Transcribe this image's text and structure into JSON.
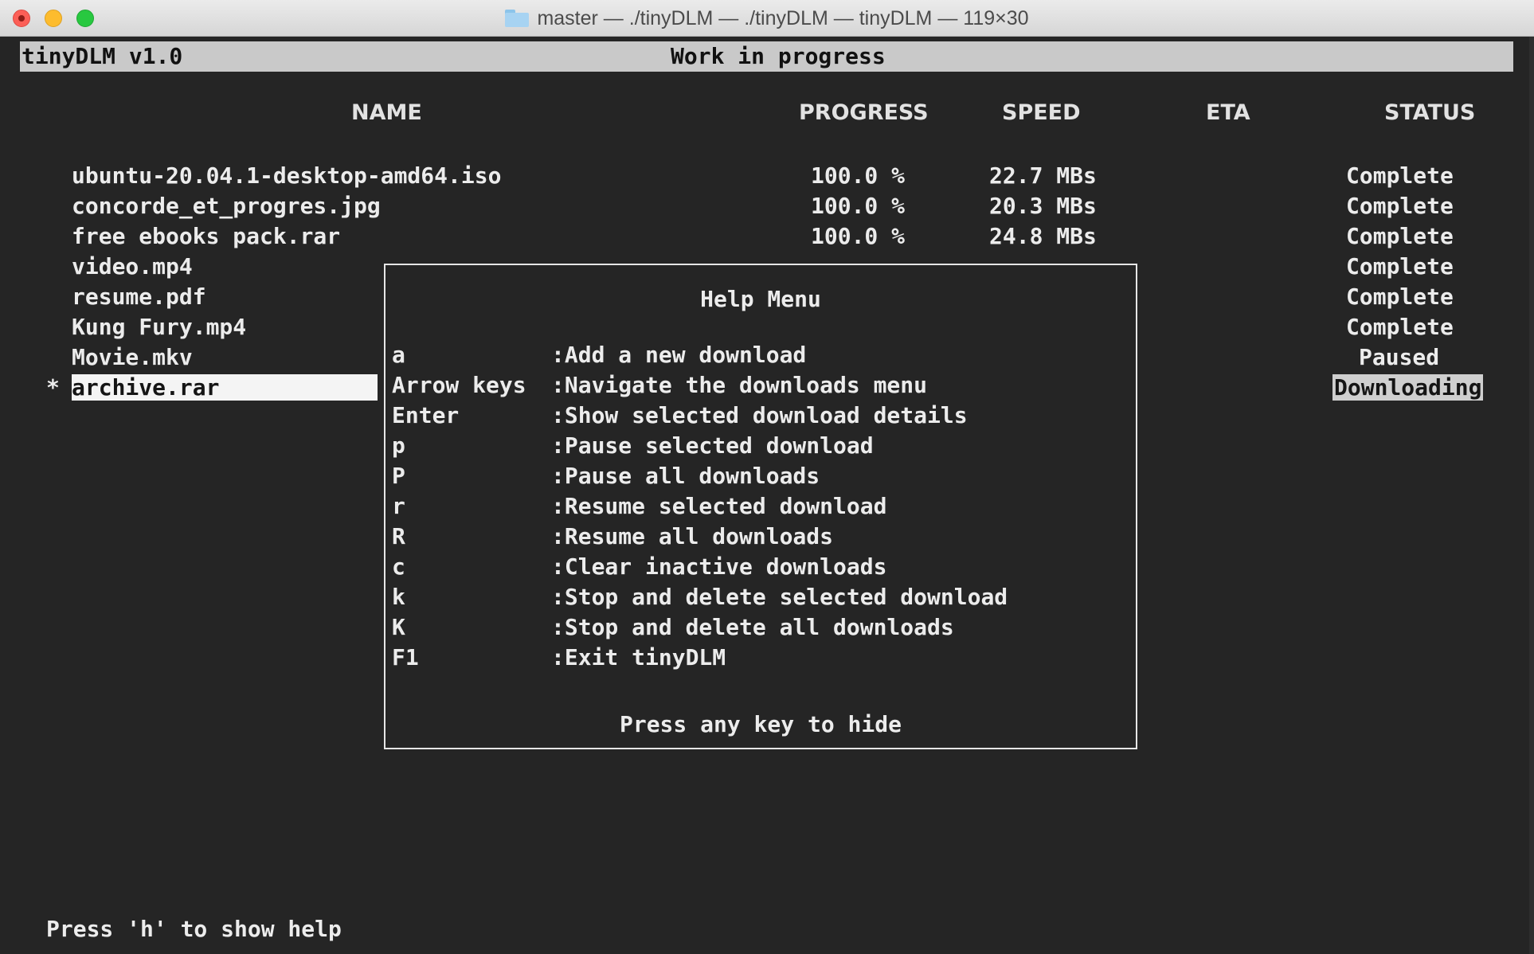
{
  "window": {
    "title": "master — ./tinyDLM — ./tinyDLM — tinyDLM — 119×30"
  },
  "header": {
    "app_name": "tinyDLM v1.0",
    "banner": "Work in progress"
  },
  "columns": {
    "name": "NAME",
    "progress": "PROGRESS",
    "speed": "SPEED",
    "eta": "ETA",
    "status": "STATUS"
  },
  "downloads": [
    {
      "marker": "",
      "name": "ubuntu-20.04.1-desktop-amd64.iso",
      "progress": "100.0 %",
      "speed": "22.7 MBs",
      "status": "Complete"
    },
    {
      "marker": "",
      "name": "concorde_et_progres.jpg",
      "progress": "100.0 %",
      "speed": "20.3 MBs",
      "status": "Complete"
    },
    {
      "marker": "",
      "name": "free ebooks pack.rar",
      "progress": "100.0 %",
      "speed": "24.8 MBs",
      "status": "Complete"
    },
    {
      "marker": "",
      "name": "video.mp4",
      "progress": "",
      "speed": "",
      "status": "Complete"
    },
    {
      "marker": "",
      "name": "resume.pdf",
      "progress": "",
      "speed": "",
      "status": "Complete"
    },
    {
      "marker": "",
      "name": "Kung Fury.mp4",
      "progress": "",
      "speed": "",
      "status": "Complete"
    },
    {
      "marker": "",
      "name": "Movie.mkv",
      "progress": "",
      "speed": "",
      "status": "Paused"
    },
    {
      "marker": "*",
      "name": "archive.rar",
      "progress": "",
      "speed": "",
      "status": "Downloading"
    }
  ],
  "help_menu": {
    "title": "Help Menu",
    "items": [
      {
        "key": "a",
        "desc": ":Add a new download"
      },
      {
        "key": "Arrow keys",
        "desc": ":Navigate the downloads menu"
      },
      {
        "key": "Enter",
        "desc": ":Show selected download details"
      },
      {
        "key": "p",
        "desc": ":Pause selected download"
      },
      {
        "key": "P",
        "desc": ":Pause all downloads"
      },
      {
        "key": "r",
        "desc": ":Resume selected download"
      },
      {
        "key": "R",
        "desc": ":Resume all downloads"
      },
      {
        "key": "c",
        "desc": ":Clear inactive downloads"
      },
      {
        "key": "k",
        "desc": ":Stop and delete selected download"
      },
      {
        "key": "K",
        "desc": ":Stop and delete all downloads"
      },
      {
        "key": "F1",
        "desc": ":Exit tinyDLM"
      }
    ],
    "footer": "Press any key to hide"
  },
  "footer_hint": "Press 'h' to show help",
  "colors": {
    "background": "#252525",
    "foreground": "#ececec",
    "header_bar": "#c9c9c9",
    "selection": "#f4f4f4"
  }
}
